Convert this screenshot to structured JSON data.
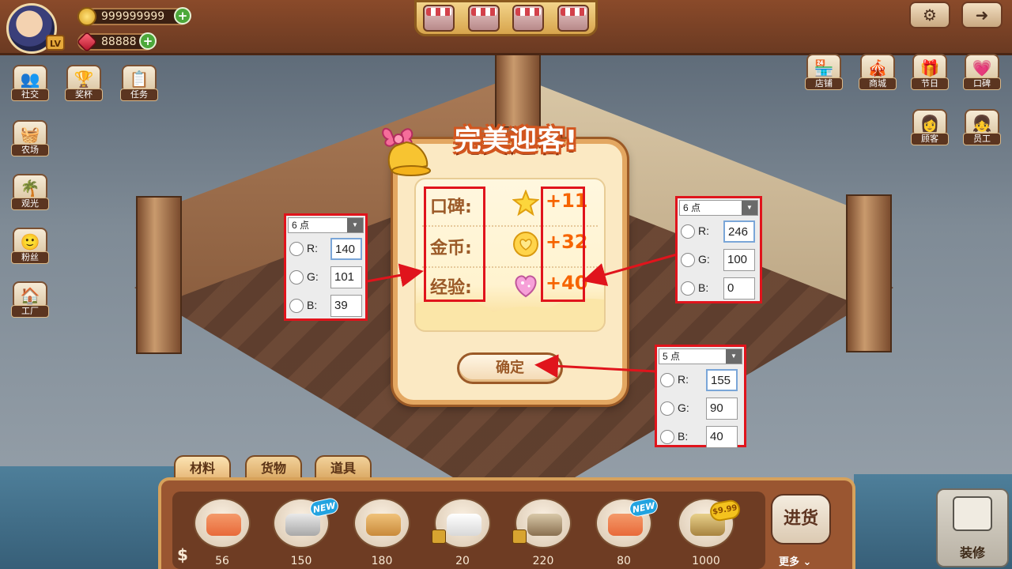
{
  "topbar": {
    "level_badge": "LV",
    "coins": "999999999",
    "gems": "88888",
    "plus": "+"
  },
  "left_menu": [
    {
      "label": "社交",
      "icon": "social-icon"
    },
    {
      "label": "奖杯",
      "icon": "trophy-icon"
    },
    {
      "label": "任务",
      "icon": "task-icon"
    },
    {
      "label": "农场",
      "icon": "farm-icon"
    },
    {
      "label": "观光",
      "icon": "sightseeing-icon"
    },
    {
      "label": "粉丝",
      "icon": "fans-icon"
    },
    {
      "label": "工厂",
      "icon": "factory-icon"
    }
  ],
  "right_menu": [
    {
      "label": "店铺",
      "icon": "store-icon"
    },
    {
      "label": "商城",
      "icon": "mall-icon"
    },
    {
      "label": "节日",
      "icon": "festival-icon"
    },
    {
      "label": "口碑",
      "icon": "reputation-heart-icon"
    },
    {
      "label": "顾客",
      "icon": "customer-icon"
    },
    {
      "label": "员工",
      "icon": "staff-icon"
    }
  ],
  "dialog": {
    "title": "完美迎客!",
    "rows": [
      {
        "label": "口碑:",
        "value": "+11",
        "icon": "star-icon"
      },
      {
        "label": "金币:",
        "value": "+32",
        "icon": "coin-icon"
      },
      {
        "label": "经验:",
        "value": "+40",
        "icon": "heart-gem-icon"
      }
    ],
    "confirm": "确定"
  },
  "pickers": [
    {
      "header": "6 点",
      "r_label": "R:",
      "g_label": "G:",
      "b_label": "B:",
      "r": "140",
      "g": "101",
      "b": "39"
    },
    {
      "header": "6 点",
      "r_label": "R:",
      "g_label": "G:",
      "b_label": "B:",
      "r": "246",
      "g": "100",
      "b": "0"
    },
    {
      "header": "5 点",
      "r_label": "R:",
      "g_label": "G:",
      "b_label": "B:",
      "r": "155",
      "g": "90",
      "b": "40"
    }
  ],
  "bottom": {
    "tabs": [
      "材料",
      "货物",
      "道具"
    ],
    "currency_symbol": "$",
    "goods": [
      {
        "price": "56",
        "icon": "salmon-plate-icon"
      },
      {
        "price": "150",
        "icon": "fish-crate-icon",
        "new": "NEW"
      },
      {
        "price": "180",
        "icon": "cookie-box-icon"
      },
      {
        "price": "20",
        "icon": "milk-eggs-icon",
        "locked": true
      },
      {
        "price": "220",
        "icon": "crate-icon",
        "locked": true
      },
      {
        "price": "80",
        "icon": "salmon-plate-icon",
        "new": "NEW"
      },
      {
        "price": "1000",
        "icon": "ship-icon",
        "tag": "$9.99"
      }
    ],
    "restock": "进货",
    "more": "更多",
    "decorate": "装修"
  },
  "colors": {
    "label_brown": "#8c6527",
    "value_orange": "#f66400",
    "button_brown": "#9b5a28",
    "annotation_red": "#e0141c"
  }
}
